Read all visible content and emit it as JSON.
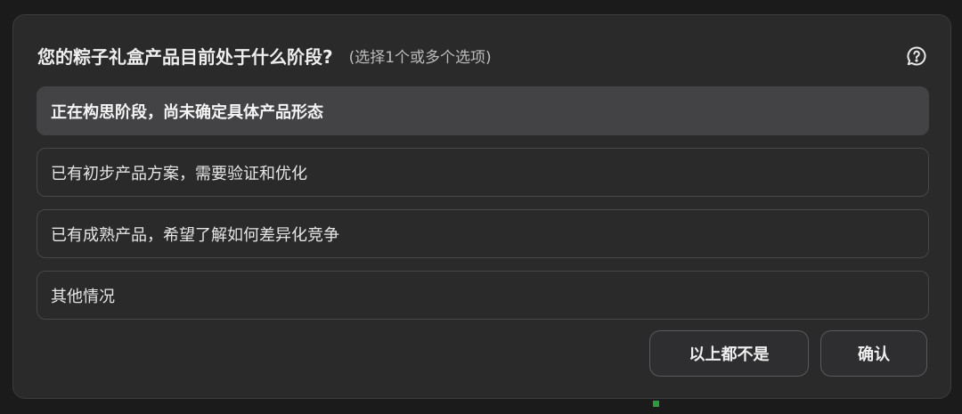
{
  "question": {
    "title": "您的粽子礼盒产品目前处于什么阶段?",
    "hint": "(选择1个或多个选项)"
  },
  "help_icon": "help-question-bubble-icon",
  "options": [
    {
      "label": "正在构思阶段，尚未确定具体产品形态",
      "selected": true
    },
    {
      "label": "已有初步产品方案，需要验证和优化",
      "selected": false
    },
    {
      "label": "已有成熟产品，希望了解如何差异化竞争",
      "selected": false
    },
    {
      "label": "其他情况",
      "selected": false
    }
  ],
  "buttons": {
    "none_label": "以上都不是",
    "confirm_label": "确认"
  },
  "colors": {
    "background": "#1b1b1c",
    "panel": "#2a2a2b",
    "selected_option": "#434346",
    "border": "#47474a",
    "indicator": "#2e9a3a"
  }
}
